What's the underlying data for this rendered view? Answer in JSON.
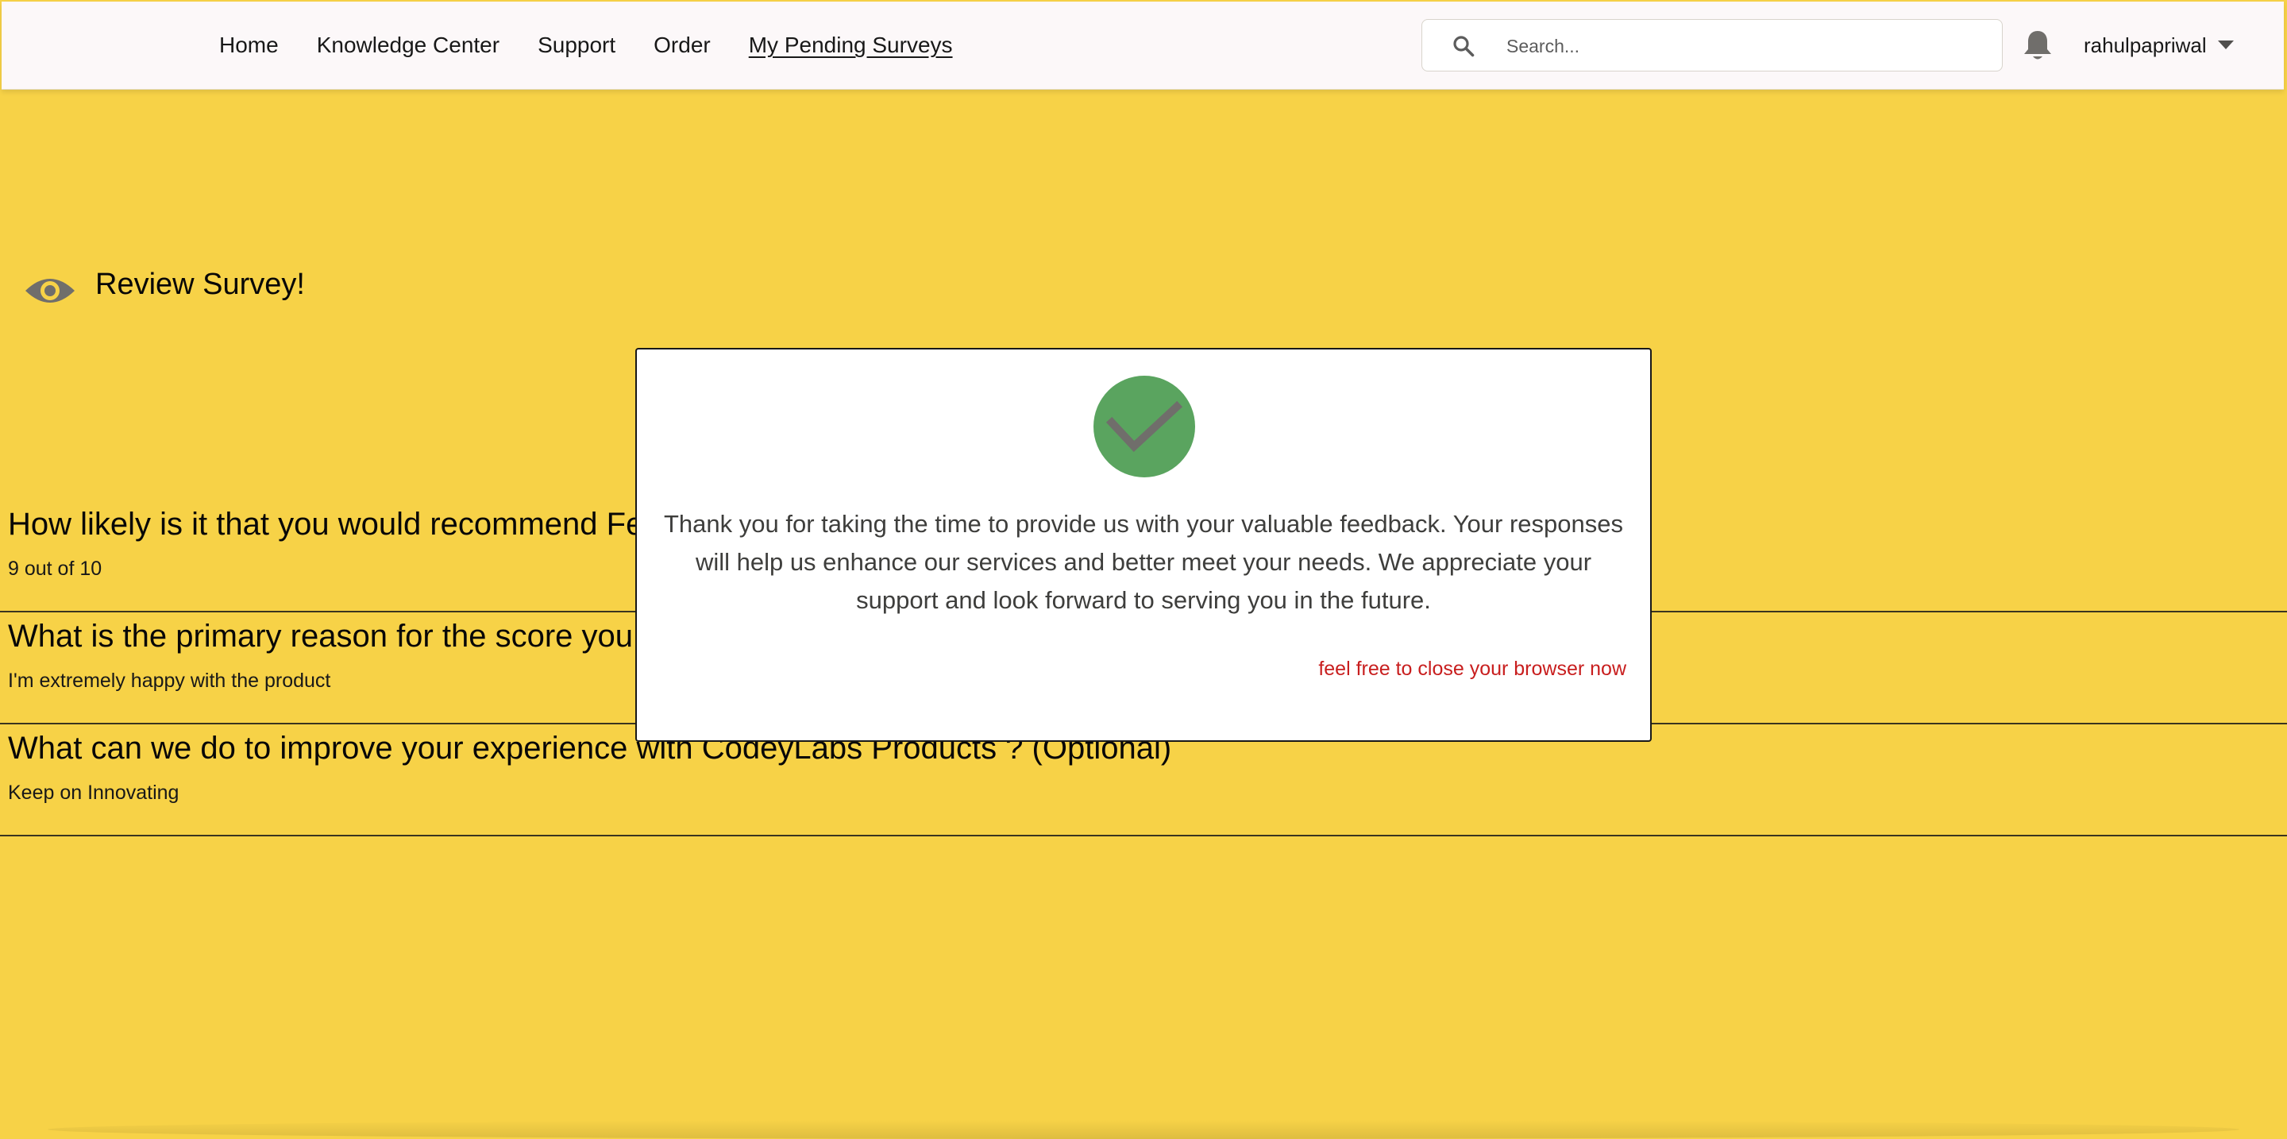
{
  "nav": {
    "items": [
      {
        "label": "Home"
      },
      {
        "label": "Knowledge Center"
      },
      {
        "label": "Support"
      },
      {
        "label": "Order"
      },
      {
        "label": "My Pending Surveys",
        "active": true
      }
    ]
  },
  "search": {
    "placeholder": "Search...",
    "icon": "search-icon"
  },
  "notifications": {
    "icon": "bell-icon"
  },
  "user": {
    "name": "rahulpapriwal",
    "menu_icon": "chevron-down-icon"
  },
  "review": {
    "icon": "eye-icon",
    "title": "Review Survey!"
  },
  "answers": [
    {
      "question": "How likely is it that you would recommend Feed",
      "answer": "9 out of 10"
    },
    {
      "question": "What is the primary reason for the score you ga",
      "answer": "I'm extremely happy with the product"
    },
    {
      "question": "What can we do to improve your experience with CodeyLabs Products ? (Optional)",
      "answer": "Keep on Innovating"
    }
  ],
  "modal": {
    "icon": "check-circle-icon",
    "message": "Thank you for taking the time to provide us with your valuable feedback. Your responses will help us enhance our services and better meet your needs. We appreciate your support and look forward to serving you in the future.",
    "note": "feel free to close your browser now"
  },
  "colors": {
    "page_background": "#f7d247",
    "success_green": "#5aa45f",
    "check_mark": "#706e6b",
    "note_red": "#c81e1e",
    "icon_gray": "#706e6b"
  }
}
